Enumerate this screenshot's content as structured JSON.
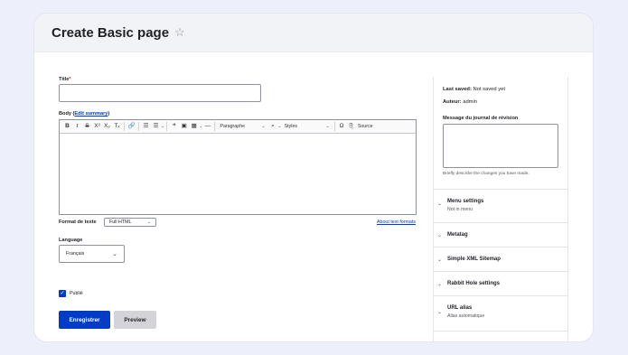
{
  "page": {
    "title": "Create Basic page"
  },
  "form": {
    "title_label": "Title",
    "required_mark": "*",
    "body_label": "Body",
    "edit_summary": "Edit summary",
    "toolbar": {
      "bold": "B",
      "italic": "I",
      "strike": "S",
      "superscript": "X²",
      "subscript": "X₂",
      "remove_format": "Tₓ",
      "link": "🔗",
      "bullet_list": "☰",
      "numbered_list": "☰",
      "blockquote": "❝",
      "image": "▣",
      "table": "▦",
      "hr": "—",
      "heading": "Paragraphe",
      "styles": "Styles",
      "source": "Source",
      "find": "⌕",
      "special": "Ω"
    },
    "format_label": "Format de texte",
    "format_value": "Full HTML",
    "about_formats": "About text formats",
    "language_label": "Language",
    "language_value": "Français",
    "publish_label": "Publié",
    "save_button": "Enregistrer",
    "preview_button": "Preview"
  },
  "sidebar": {
    "last_saved_label": "Last saved:",
    "last_saved_value": "Not saved yet",
    "author_label": "Auteur:",
    "author_value": "admin",
    "revision_label": "Message du journal de révision",
    "revision_help": "Briefly describe the changes you have made.",
    "sections": [
      {
        "title": "Menu settings",
        "summary": "Not in menu"
      },
      {
        "title": "Metatag",
        "summary": ""
      },
      {
        "title": "Simple XML Sitemap",
        "summary": ""
      },
      {
        "title": "Rabbit Hole settings",
        "summary": ""
      },
      {
        "title": "URL alias",
        "summary": "Alias automatique"
      }
    ]
  }
}
